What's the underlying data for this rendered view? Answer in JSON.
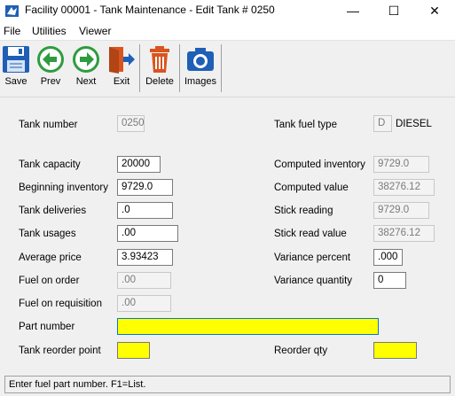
{
  "window": {
    "title": "Facility 00001 - Tank Maintenance - Edit Tank # 0250",
    "minimize_glyph": "—",
    "maximize_glyph": "☐",
    "close_glyph": "✕"
  },
  "menu": {
    "file": "File",
    "utilities": "Utilities",
    "viewer": "Viewer"
  },
  "toolbar": {
    "save": "Save",
    "prev": "Prev",
    "next": "Next",
    "exit": "Exit",
    "delete": "Delete",
    "images": "Images",
    "icons": [
      "floppy-disk-icon",
      "left-arrow-icon",
      "right-arrow-icon",
      "exit-door-icon",
      "trash-can-icon",
      "camera-icon"
    ],
    "colors": {
      "save": "#1f5fb5",
      "nav": "#2e9c3e",
      "exit": "#d9541e",
      "delete": "#d9541e",
      "images": "#1f5fb5"
    }
  },
  "form": {
    "tank_number": {
      "label": "Tank number",
      "value": "0250"
    },
    "tank_fuel_type": {
      "label": "Tank fuel type",
      "code": "D",
      "description": "DIESEL"
    },
    "tank_capacity": {
      "label": "Tank capacity",
      "value": "20000"
    },
    "computed_inventory": {
      "label": "Computed inventory",
      "value": "9729.0"
    },
    "beginning_inventory": {
      "label": "Beginning inventory",
      "value": "9729.0"
    },
    "computed_value": {
      "label": "Computed value",
      "value": "38276.12"
    },
    "tank_deliveries": {
      "label": "Tank deliveries",
      "value": ".0"
    },
    "stick_reading": {
      "label": "Stick reading",
      "value": "9729.0"
    },
    "tank_usages": {
      "label": "Tank usages",
      "value": ".00"
    },
    "stick_read_value": {
      "label": "Stick read value",
      "value": "38276.12"
    },
    "average_price": {
      "label": "Average price",
      "value": "3.93423"
    },
    "variance_percent": {
      "label": "Variance percent",
      "value": ".000"
    },
    "fuel_on_order": {
      "label": "Fuel on order",
      "value": ".00"
    },
    "variance_quantity": {
      "label": "Variance quantity",
      "value": "0"
    },
    "fuel_on_requisition": {
      "label": "Fuel on requisition",
      "value": ".00"
    },
    "part_number": {
      "label": "Part number",
      "value": ""
    },
    "tank_reorder_point": {
      "label": "Tank reorder point",
      "value": ""
    },
    "reorder_qty": {
      "label": "Reorder qty",
      "value": ""
    }
  },
  "status": {
    "message": "Enter fuel part number. F1=List."
  },
  "colors": {
    "required_field": "#ffff00",
    "focus_border": "#0078d7",
    "form_background": "#f0f0f0"
  }
}
